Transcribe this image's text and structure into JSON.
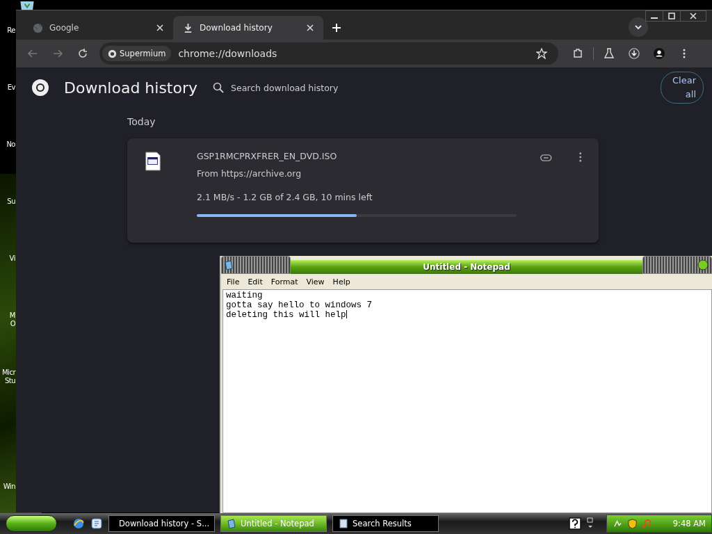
{
  "desktop_icons": [
    {
      "lines": [
        "Re"
      ]
    },
    {
      "lines": [
        "Ev"
      ]
    },
    {
      "lines": [
        "No"
      ]
    },
    {
      "lines": [
        "Su"
      ]
    },
    {
      "lines": [
        "Vi"
      ]
    },
    {
      "lines": [
        "M",
        "O"
      ]
    },
    {
      "lines": [
        "Micr",
        "Stu"
      ]
    },
    {
      "lines": [
        "Win"
      ]
    }
  ],
  "browser": {
    "tabs": [
      {
        "title": "Google",
        "selected": false,
        "kind": "globe"
      },
      {
        "title": "Download history",
        "selected": true,
        "kind": "download"
      }
    ],
    "address": {
      "chip": "Supermium",
      "url": "chrome://downloads"
    },
    "page": {
      "title": "Download history",
      "search": {
        "placeholder": "Search download history"
      },
      "clear_button": "Clear all",
      "section": "Today",
      "downloads": [
        {
          "filename": "GSP1RMCPRXFRER_EN_DVD.ISO",
          "source": "From https://archive.org",
          "status": "2.1 MB/s - 1.2 GB of 2.4 GB, 10 mins left",
          "level": 0.5
        }
      ]
    }
  },
  "notepad": {
    "title": "Untitled - Notepad",
    "menu": [
      "File",
      "Edit",
      "Format",
      "View",
      "Help"
    ],
    "lines": [
      "waiting",
      "gotta say hello to windows 7",
      "deleting this will help"
    ]
  },
  "taskbar": {
    "tasks": [
      {
        "label": "Download history - S...",
        "selected": false,
        "kind": "browser"
      },
      {
        "label": "Untitled - Notepad",
        "selected": true,
        "kind": "notepad"
      },
      {
        "label": "Search Results",
        "selected": false,
        "kind": "search"
      }
    ],
    "clock": "9:48 AM"
  }
}
